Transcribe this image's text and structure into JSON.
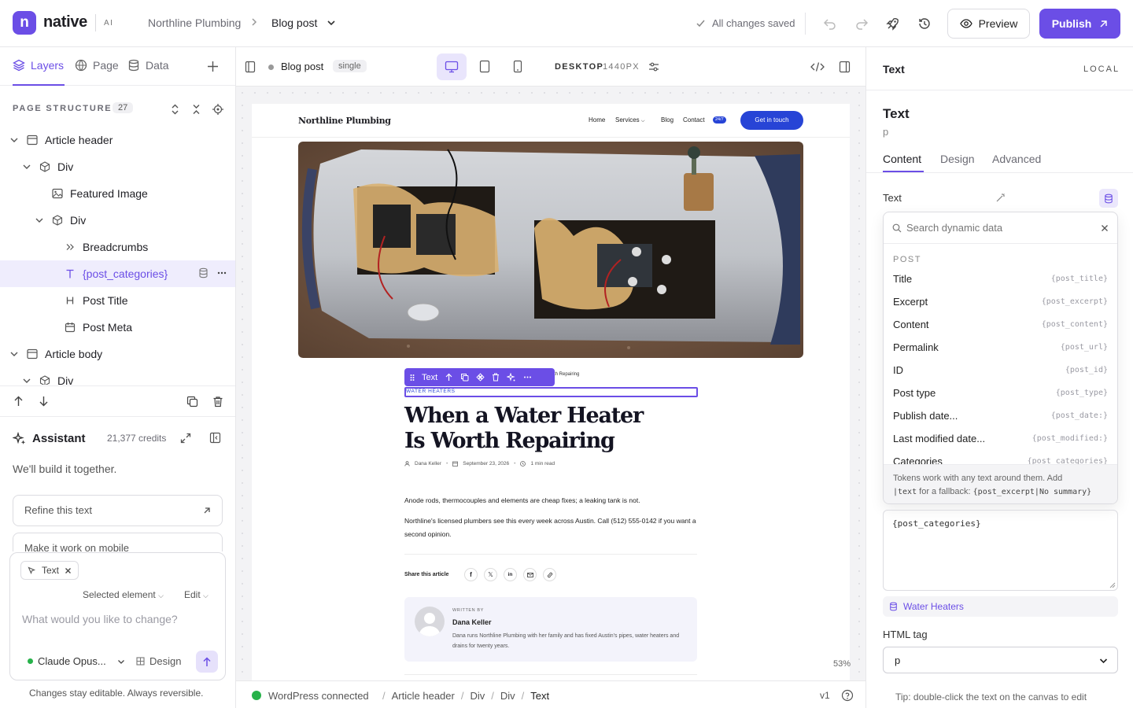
{
  "topbar": {
    "logo_letter": "n",
    "brand": "native",
    "brand_suffix": "AI",
    "site_name": "Northline Plumbing",
    "page_name": "Blog post",
    "save_status": "All changes saved",
    "preview_label": "Preview",
    "publish_label": "Publish"
  },
  "left_panel": {
    "tabs": [
      {
        "label": "Layers",
        "icon": "layers-icon",
        "active": true
      },
      {
        "label": "Page",
        "icon": "globe-icon"
      },
      {
        "label": "Data",
        "icon": "database-icon"
      }
    ],
    "structure_title": "PAGE STRUCTURE",
    "structure_count": "27",
    "tree": [
      {
        "label": "Article header",
        "icon": "section-icon",
        "expanded": true
      },
      {
        "label": "Div",
        "icon": "cube-icon",
        "expanded": true
      },
      {
        "label": "Featured Image",
        "icon": "image-icon"
      },
      {
        "label": "Div",
        "icon": "cube-icon",
        "expanded": true
      },
      {
        "label": "Breadcrumbs",
        "icon": "breadcrumb-icon"
      },
      {
        "label": "{post_categories}",
        "icon": "text-icon",
        "selected": true
      },
      {
        "label": "Post Title",
        "icon": "heading-icon"
      },
      {
        "label": "Post Meta",
        "icon": "calendar-icon"
      },
      {
        "label": "Article body",
        "icon": "section-icon",
        "expanded": true
      },
      {
        "label": "Div",
        "icon": "cube-icon",
        "expanded": true
      }
    ]
  },
  "assistant": {
    "title": "Assistant",
    "credits": "21,377 credits",
    "subtitle": "We'll build it together.",
    "suggestions": [
      "Refine this text",
      "Make it work on mobile"
    ],
    "context_chip": "Text",
    "scope": "Selected element",
    "mode": "Edit",
    "placeholder": "What would you like to change?",
    "model": "Claude Opus...",
    "design_label": "Design",
    "footer": "Changes stay editable. Always reversible."
  },
  "canvas": {
    "page_label": "Blog post",
    "page_type": "single",
    "device": "DESKTOP",
    "width_label": "1440PX",
    "zoom": "53%"
  },
  "site": {
    "logo": "Northline Plumbing",
    "nav": [
      "Home",
      "Services",
      "Blog",
      "Contact"
    ],
    "nav_badge": "24/7",
    "cta": "Get in touch",
    "breadcrumb_tail": "th Repairing",
    "category": "WATER HEATERS",
    "title_line1": "When a Water Heater",
    "title_line2": "Is Worth Repairing",
    "author": "Dana Keller",
    "date": "September 23, 2026",
    "read_time": "1 min read",
    "para1": "Anode rods, thermocouples and elements are cheap fixes; a leaking tank is not.",
    "para2": "Northline's licensed plumbers see this every week across Austin. Call (512) 555-0142 if you want a second opinion.",
    "share_label": "Share this article",
    "written_by": "WRITTEN BY",
    "author_bio": "Dana runs Northline Plumbing with her family and has fixed Austin's pipes, water heaters and drains for twenty years."
  },
  "element_toolbar": {
    "label": "Text"
  },
  "statusbar": {
    "connection": "WordPress connected",
    "path": [
      "Article header",
      "Div",
      "Div",
      "Text"
    ],
    "version": "v1"
  },
  "right_panel": {
    "header_title": "Text",
    "header_scope": "LOCAL",
    "element_name": "Text",
    "element_tag": "p",
    "tabs": [
      "Content",
      "Design",
      "Advanced"
    ],
    "text_label": "Text",
    "search_placeholder": "Search dynamic data",
    "group": "POST",
    "fields": [
      {
        "label": "Title",
        "token": "{post_title}"
      },
      {
        "label": "Excerpt",
        "token": "{post_excerpt}"
      },
      {
        "label": "Content",
        "token": "{post_content}"
      },
      {
        "label": "Permalink",
        "token": "{post_url}"
      },
      {
        "label": "ID",
        "token": "{post_id}"
      },
      {
        "label": "Post type",
        "token": "{post_type}"
      },
      {
        "label": "Publish date...",
        "token": "{post_date:}"
      },
      {
        "label": "Last modified date...",
        "token": "{post_modified:}"
      },
      {
        "label": "Categories",
        "token": "{post_categories}"
      }
    ],
    "hint_line1": "Tokens work with any text around them. Add",
    "hint_code1": "|text",
    "hint_mid": " for a fallback: ",
    "hint_code2": "{post_excerpt|No summary}",
    "textarea_value": "{post_categories}",
    "resolved_value": "Water Heaters",
    "html_tag_label": "HTML tag",
    "html_tag_value": "p",
    "tip": "Tip: double-click the text on the canvas to edit"
  },
  "colors": {
    "accent": "#6b4ee6",
    "cta_blue": "#2744d6",
    "success": "#27b24a"
  }
}
